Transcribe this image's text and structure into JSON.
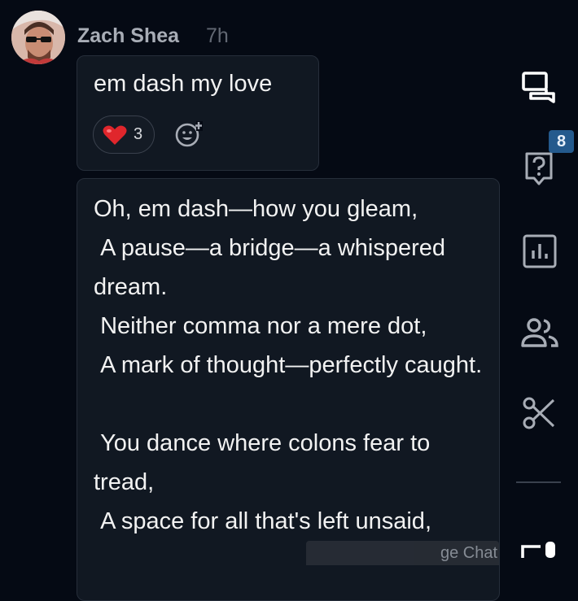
{
  "message": {
    "author": "Zach Shea",
    "time": "7h",
    "text": "em dash my love",
    "reaction": {
      "emoji": "heart",
      "count": "3"
    }
  },
  "reply": {
    "text": "Oh, em dash—how you gleam,\n A pause—a bridge—a whispered dream.\n Neither comma nor a mere dot,\n A mark of thought—perfectly caught.\n\n You dance where colons fear to tread,\n A space for all that's left unsaid,"
  },
  "tooltip": {
    "text": "ge Chat"
  },
  "sidebar": {
    "icons": [
      "chat-icon",
      "question-icon",
      "poll-icon",
      "people-icon",
      "scissors-icon",
      "share-icon"
    ],
    "questions_badge": "8"
  }
}
